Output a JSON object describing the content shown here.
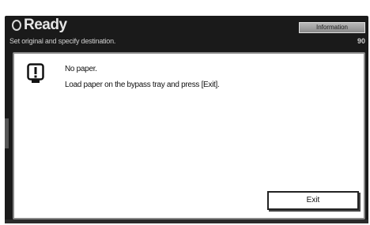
{
  "header": {
    "status": "Ready",
    "info_label": "Information",
    "sub_message": "Set original and specify destination.",
    "page_count": "90"
  },
  "dialog": {
    "icon": "alert-exclamation-icon",
    "line1": "No paper.",
    "line2": "Load paper on the bypass tray and press [Exit].",
    "exit_label": "Exit"
  }
}
